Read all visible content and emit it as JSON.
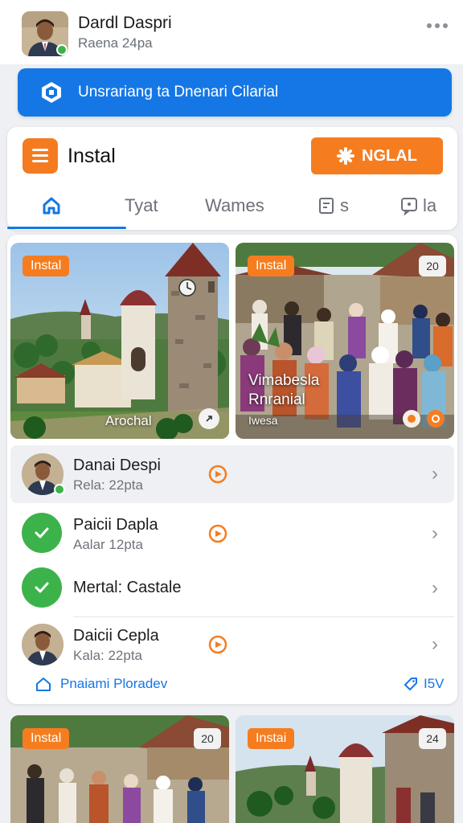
{
  "profile": {
    "name": "Dardl Daspri",
    "subtitle": "Raena 24pa"
  },
  "banner": {
    "text": "Unsrariang ta Dnenari Cilarial"
  },
  "install_card": {
    "title": "Instal",
    "action_label": "NGLAL",
    "tabs": [
      {
        "label": ""
      },
      {
        "label": "Tyat"
      },
      {
        "label": "Wames"
      },
      {
        "label": "s"
      },
      {
        "label": "la"
      }
    ]
  },
  "tiles": [
    {
      "tag": "Instal",
      "caption": "Arochal"
    },
    {
      "tag": "Instal",
      "count": "20",
      "title_line1": "Vimabesla",
      "title_line2": "Rnranial",
      "subtitle": "Iwesa"
    }
  ],
  "list": [
    {
      "title": "Danai Despi",
      "subtitle": "Rela: 22pta"
    },
    {
      "title": "Paicii Dapla",
      "subtitle": "Aalar 12pta"
    },
    {
      "title": "Mertal: Castale",
      "subtitle": ""
    },
    {
      "title": "Daicii Cepla",
      "subtitle": "Kala: 22pta"
    }
  ],
  "footer": {
    "link_label": "Pnaiami Ploradev",
    "right_label": "I5V"
  },
  "bottom_tiles": [
    {
      "tag": "Instal",
      "count": "20"
    },
    {
      "tag": "Instai",
      "count": "24"
    }
  ],
  "colors": {
    "accent_blue": "#1577e6",
    "accent_orange": "#f57d20",
    "success_green": "#3cb34a"
  }
}
